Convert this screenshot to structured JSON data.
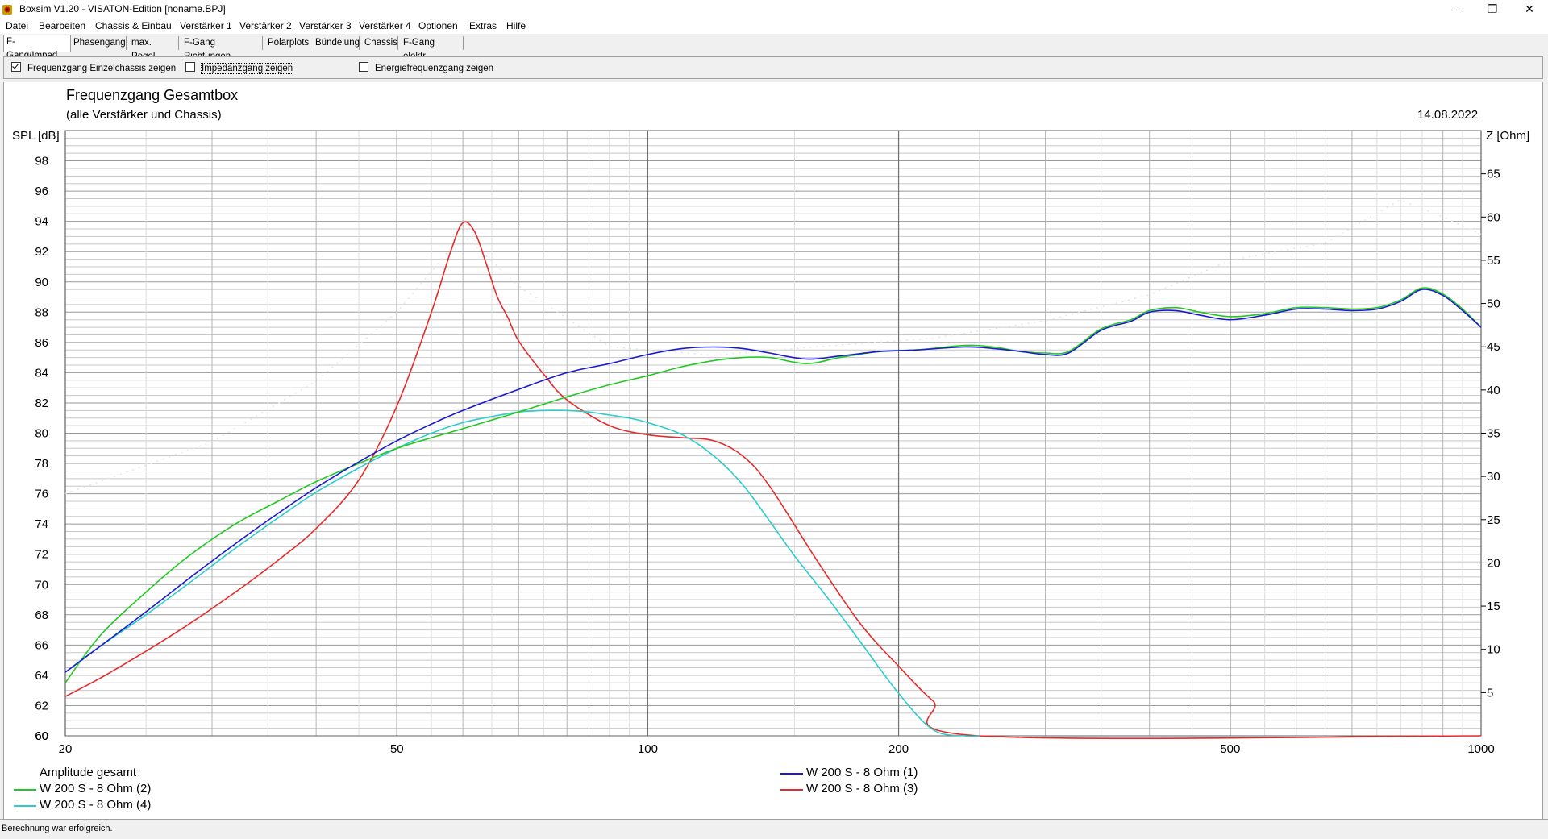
{
  "window": {
    "title": "Boxsim V1.20 - VISATON-Edition [noname.BPJ]",
    "minimize": "–",
    "restore": "❐",
    "close": "✕"
  },
  "menu": [
    "Datei",
    "Bearbeiten",
    "Chassis & Einbau",
    "Verstärker 1",
    "Verstärker 2",
    "Verstärker 3",
    "Verstärker 4",
    "Optionen",
    "Extras",
    "Hilfe"
  ],
  "tabs": [
    "F-Gang/Imped.",
    "Phasengang",
    "max. Pegel",
    "F-Gang Richtungen",
    "Polarplots",
    "Bündelung",
    "Chassis",
    "F-Gang elektr."
  ],
  "active_tab": 0,
  "options": [
    {
      "label": "Frequenzgang Einzelchassis zeigen",
      "checked": true
    },
    {
      "label": "Impedanzgang zeigen",
      "checked": false
    },
    {
      "label": "Energiefrequenzgang zeigen",
      "checked": false
    }
  ],
  "status": "Berechnung war erfolgreich.",
  "colors": {
    "green": "#22c822",
    "blue": "#1a1ad2",
    "cyan": "#2ccccc",
    "red": "#e62a2a",
    "grid": "#b4b4b4",
    "gridMajor": "#707070"
  },
  "chart_data": {
    "type": "line",
    "title": "Frequenzgang Gesamtbox",
    "subtitle": "(alle Verstärker und Chassis)",
    "date": "14.08.2022",
    "ylabel_left": "SPL [dB]",
    "ylabel_right": "Z [Ohm]",
    "x_scale": "log",
    "xlim": [
      20,
      1000
    ],
    "ylim_left": [
      60,
      100
    ],
    "ylim_right": [
      0,
      70
    ],
    "x_ticks": [
      20,
      50,
      100,
      200,
      500,
      1000
    ],
    "y_ticks_left": [
      60,
      62,
      64,
      66,
      68,
      70,
      72,
      74,
      76,
      78,
      80,
      82,
      84,
      86,
      88,
      90,
      92,
      94,
      96,
      98
    ],
    "y_ticks_right": [
      5,
      10,
      15,
      20,
      25,
      30,
      35,
      40,
      45,
      50,
      55,
      60,
      65
    ],
    "legend_title": "Amplitude gesamt",
    "series": [
      {
        "name": "W 200 S - 8 Ohm (2)",
        "color": "green",
        "x": [
          20,
          22,
          25,
          28,
          32,
          36,
          40,
          45,
          50,
          55,
          60,
          70,
          80,
          90,
          100,
          110,
          120,
          130,
          140,
          155,
          170,
          190,
          210,
          240,
          260,
          280,
          300,
          320,
          350,
          380,
          400,
          430,
          460,
          500,
          550,
          600,
          650,
          700,
          750,
          800,
          850,
          900,
          950,
          1000
        ],
        "y": [
          63.5,
          66.6,
          69.5,
          71.8,
          74,
          75.5,
          76.8,
          78,
          79,
          79.7,
          80.3,
          81.4,
          82.4,
          83.2,
          83.8,
          84.4,
          84.8,
          85,
          85,
          84.6,
          85,
          85.4,
          85.5,
          85.8,
          85.7,
          85.4,
          85.3,
          85.4,
          86.9,
          87.5,
          88.1,
          88.3,
          88,
          87.7,
          87.9,
          88.3,
          88.3,
          88.2,
          88.3,
          88.8,
          89.6,
          89.2,
          88.2,
          87
        ]
      },
      {
        "name": "W 200 S - 8 Ohm (1)",
        "color": "blue",
        "x": [
          20,
          22,
          25,
          28,
          32,
          36,
          40,
          45,
          50,
          55,
          60,
          70,
          80,
          90,
          100,
          110,
          120,
          130,
          140,
          155,
          170,
          190,
          210,
          240,
          260,
          280,
          300,
          320,
          350,
          380,
          400,
          430,
          460,
          500,
          550,
          600,
          650,
          700,
          750,
          800,
          850,
          900,
          950,
          1000
        ],
        "y": [
          64.2,
          65.9,
          68.2,
          70.3,
          72.7,
          74.7,
          76.4,
          78.1,
          79.5,
          80.6,
          81.5,
          82.9,
          84,
          84.6,
          85.2,
          85.6,
          85.7,
          85.6,
          85.3,
          84.9,
          85.1,
          85.4,
          85.5,
          85.7,
          85.6,
          85.4,
          85.2,
          85.3,
          86.8,
          87.4,
          88,
          88.1,
          87.8,
          87.5,
          87.8,
          88.2,
          88.2,
          88.1,
          88.2,
          88.7,
          89.5,
          89.1,
          88.1,
          87
        ]
      },
      {
        "name": "W 200 S - 8 Ohm (4)",
        "color": "cyan",
        "x": [
          20,
          22,
          25,
          28,
          32,
          36,
          40,
          45,
          50,
          55,
          60,
          65,
          70,
          75,
          80,
          85,
          90,
          95,
          100,
          110,
          120,
          130,
          140,
          150,
          165,
          180,
          200,
          220,
          240,
          250
        ],
        "y": [
          64.2,
          65.9,
          68,
          70,
          72.4,
          74.4,
          76.1,
          77.7,
          79,
          80,
          80.7,
          81.1,
          81.4,
          81.5,
          81.5,
          81.4,
          81.2,
          81,
          80.7,
          79.9,
          78.5,
          76.6,
          74.2,
          71.9,
          69,
          66.2,
          62.8,
          60.4,
          60.0,
          60.0
        ]
      },
      {
        "name": "W 200 S - 8 Ohm (3)",
        "color": "red",
        "x": [
          20,
          22,
          25,
          28,
          32,
          36,
          40,
          45,
          50,
          55,
          58,
          60,
          62,
          64,
          66,
          68,
          70,
          75,
          80,
          90,
          100,
          110,
          120,
          130,
          140,
          160,
          180,
          200,
          220,
          250,
          1000
        ],
        "y": [
          62.6,
          63.8,
          65.6,
          67.3,
          69.5,
          71.6,
          73.7,
          76.9,
          81.8,
          88,
          92,
          93.9,
          93.3,
          91.2,
          89,
          87.6,
          86.1,
          83.9,
          82.2,
          80.5,
          79.9,
          79.7,
          79.5,
          78.5,
          76.5,
          71.5,
          67.4,
          64.6,
          62.3,
          60.0,
          60.0
        ]
      }
    ]
  }
}
